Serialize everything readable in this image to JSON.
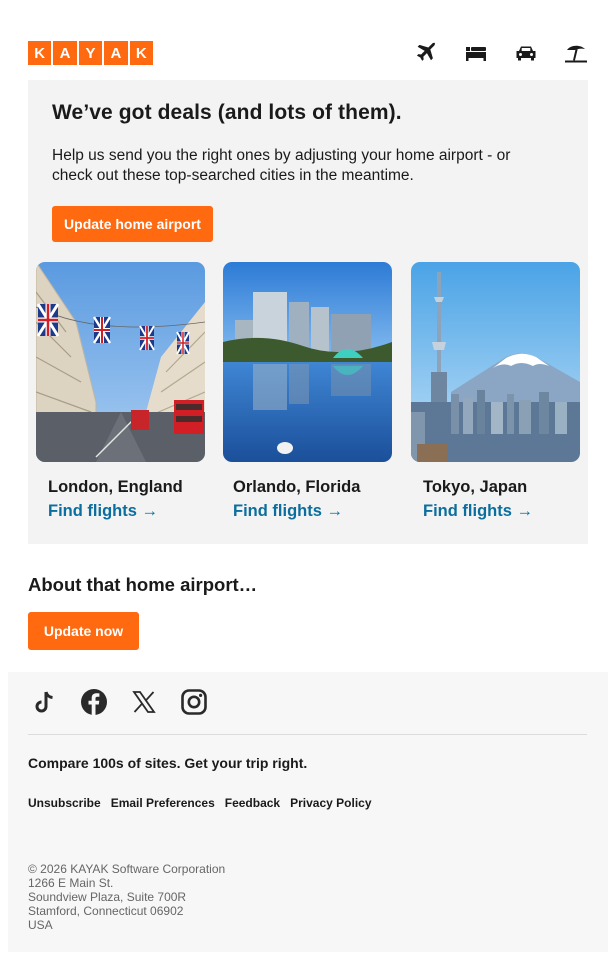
{
  "brand": {
    "letters": [
      "K",
      "A",
      "Y",
      "A",
      "K"
    ],
    "color": "#ff690f"
  },
  "nav": {
    "icons": [
      "flights-icon",
      "hotels-icon",
      "cars-icon",
      "vacation-icon"
    ]
  },
  "deals": {
    "title": "We’ve got deals (and lots of them).",
    "lead": "Help us send you the right ones by adjusting your home airport - or check out these top-searched cities in the meantime.",
    "button_label": "Update home airport",
    "cities": [
      {
        "name": "London, England",
        "link": "Find flights →"
      },
      {
        "name": "Orlando, Florida",
        "link": "Find flights →"
      },
      {
        "name": "Tokyo, Japan",
        "link": "Find flights →"
      }
    ]
  },
  "about": {
    "title": "About that home airport…",
    "button_label": "Update now"
  },
  "footer": {
    "social": [
      "tiktok-icon",
      "facebook-icon",
      "x-icon",
      "instagram-icon"
    ],
    "tagline": "Compare 100s of sites. Get your trip right.",
    "links": [
      "Unsubscribe",
      "Email Preferences",
      "Feedback",
      "Privacy Policy"
    ],
    "address": [
      "© 2026 KAYAK Software Corporation",
      "1266 E Main St.",
      "Soundview Plaza, Suite 700R",
      "Stamford, Connecticut 06902",
      "USA"
    ]
  },
  "colors": {
    "accent": "#ff690f",
    "link": "#0b6e9e",
    "card_bg": "#f3f3f3",
    "footer_bg": "#f7f7f7"
  }
}
